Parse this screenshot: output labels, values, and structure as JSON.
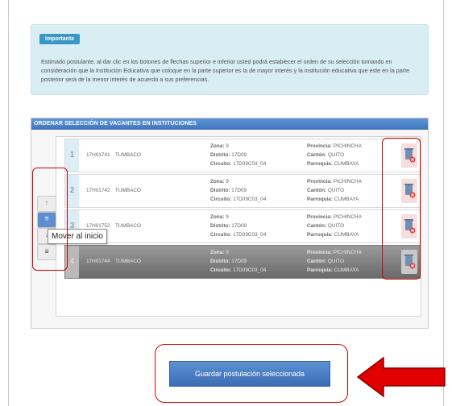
{
  "info": {
    "badge": "Importante",
    "text": "Estimado postulante, al dar clic en los botones de flechas superior e inferior usted podrá establecer el orden de su selección tomando en consideración que la Institución Educativa que coloque en la parte superior es la de mayor interés y la institución educativa que este en la parte posterior será de la menor interés de acuerdo a sus preferencias."
  },
  "panel": {
    "title": "ORDENAR SELECCIÓN DE VACANTES EN INSTITUCIONES"
  },
  "rows": [
    {
      "num": "1",
      "code": "17H01741",
      "parish": "TUMBACO",
      "zona": "9",
      "distrito": "17D09",
      "circuito": "17D09C03_04",
      "provincia": "PICHINCHA",
      "canton": "QUITO",
      "parroquia": "CUMBAYA"
    },
    {
      "num": "2",
      "code": "17H01742",
      "parish": "TUMBACO",
      "zona": "9",
      "distrito": "17D09",
      "circuito": "17D09C03_04",
      "provincia": "PICHINCHA",
      "canton": "QUITO",
      "parroquia": "CUMBAYA"
    },
    {
      "num": "3",
      "code": "17H01752",
      "parish": "TUMBACO",
      "zona": "9",
      "distrito": "17D09",
      "circuito": "17D09C03_04",
      "provincia": "PICHINCHA",
      "canton": "QUITO",
      "parroquia": "CUMBAYA"
    },
    {
      "num": "4",
      "code": "17H01744",
      "parish": "TUMBACO",
      "zona": "9",
      "distrito": "17D09",
      "circuito": "17D09C03_04",
      "provincia": "PICHINCHA",
      "canton": "QUITO",
      "parroquia": "CUMBAYA"
    }
  ],
  "labels": {
    "zona": "Zona:",
    "distrito": "Distrito:",
    "circuito": "Circuito:",
    "provincia": "Provincia:",
    "canton": "Cantón:",
    "parroquia": "Parroquia:"
  },
  "arrows": {
    "up": "↑",
    "top": "⇈",
    "down": "↓",
    "bottom": "⇊"
  },
  "tooltip": "Mover al inicio",
  "save_button": "Guardar postulación seleccionada",
  "colors": {
    "accent": "#3b6db5",
    "highlight": "#d10000",
    "info_bg": "#d9eef2"
  }
}
